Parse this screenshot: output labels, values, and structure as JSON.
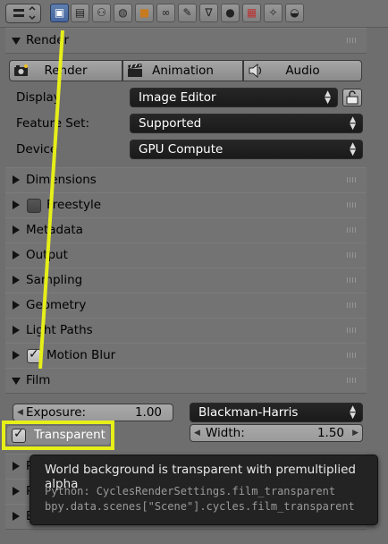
{
  "header": {
    "icons": [
      "editor-type-icon",
      "camera-render-icon",
      "layers-icon",
      "scene-icon",
      "world-icon",
      "object-icon",
      "constraints-icon",
      "modifier-wrench-icon",
      "vertex-data-icon",
      "material-icon",
      "texture-icon",
      "particles-icon",
      "physics-icon"
    ]
  },
  "render_panel": {
    "title": "Render",
    "buttons": [
      "Render",
      "Animation",
      "Audio"
    ],
    "display_label": "Display",
    "display_value": "Image Editor",
    "feature_set_label": "Feature Set:",
    "feature_set_value": "Supported",
    "device_label": "Device",
    "device_value": "GPU Compute"
  },
  "collapsed_panels": [
    "Dimensions",
    "Freestyle",
    "Metadata",
    "Output",
    "Sampling",
    "Geometry",
    "Light Paths",
    "Motion Blur"
  ],
  "film_panel": {
    "title": "Film",
    "exposure_label": "Exposure:",
    "exposure_value": "1.00",
    "filter_value": "Blackman-Harris",
    "width_label": "Width:",
    "width_value": "1.50",
    "transparent_label": "Transparent",
    "transparent_checked": true
  },
  "partial_panels": [
    "P",
    "P",
    "B"
  ],
  "tooltip": {
    "description": "World background is transparent with premultiplied alpha",
    "python_line": "Python: CyclesRenderSettings.film_transparent",
    "data_path": "bpy.data.scenes[\"Scene\"].cycles.film_transparent"
  },
  "colors": {
    "highlight": "#e6ef18",
    "active_tab": "#4f71a8",
    "panel_bg": "#727272",
    "dropdown_bg": "#1f1f1f"
  }
}
